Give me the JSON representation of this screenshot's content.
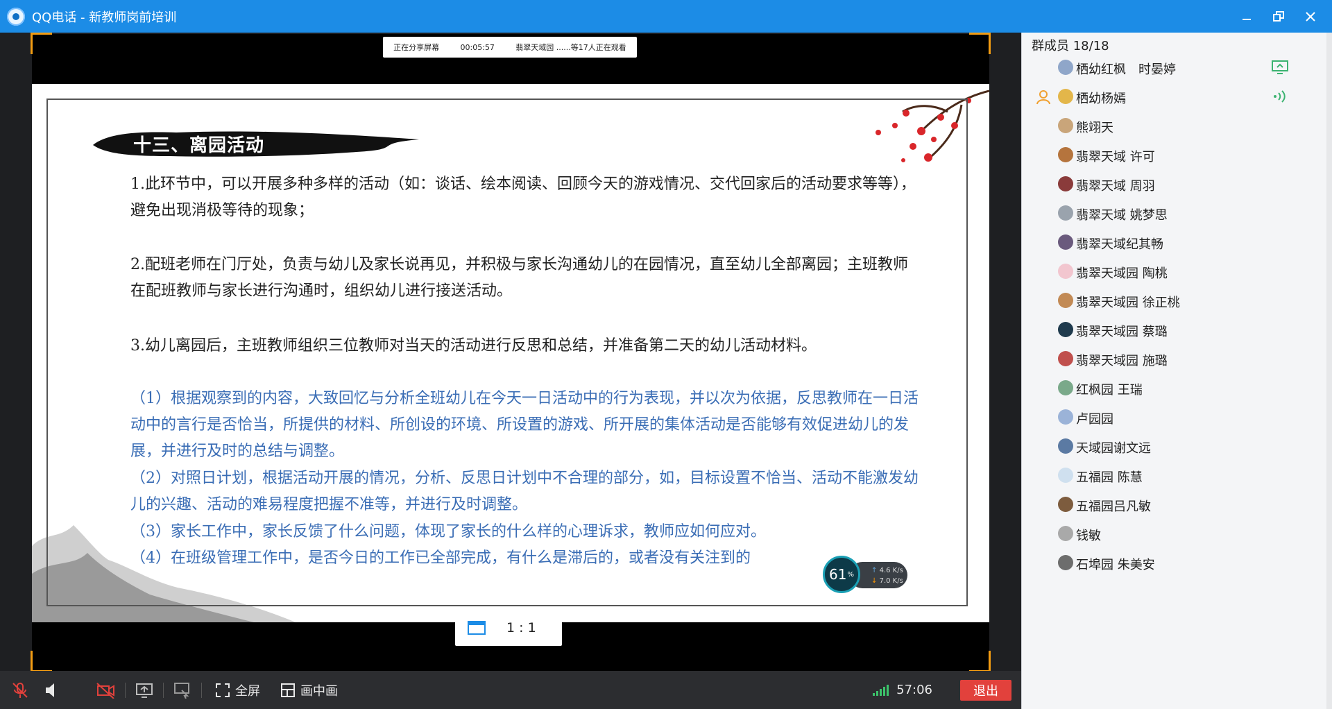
{
  "window": {
    "title": "QQ电话 - 新教师岗前培训"
  },
  "share_status": {
    "label": "正在分享屏幕",
    "elapsed": "00:05:57",
    "viewers": "翡翠天域园 ......等17人正在观看"
  },
  "slide": {
    "heading": "十三、离园活动",
    "paragraphs": [
      "1.此环节中，可以开展多种多样的活动（如：谈话、绘本阅读、回顾今天的游戏情况、交代回家后的活动要求等等），避免出现消极等待的现象；",
      "2.配班老师在门厅处，负责与幼儿及家长说再见，并积极与家长沟通幼儿的在园情况，直至幼儿全部离园；主班教师在配班教师与家长进行沟通时，组织幼儿进行接送活动。",
      "3.幼儿离园后，主班教师组织三位教师对当天的活动进行反思和总结，并准备第二天的幼儿活动材料。"
    ],
    "sub_points": [
      "（1）根据观察到的内容，大致回忆与分析全班幼儿在今天一日活动中的行为表现，并以次为依据，反思教师在一日活动中的言行是否恰当，所提供的材料、所创设的环境、所设置的游戏、所开展的集体活动是否能够有效促进幼儿的发展，并进行及时的总结与调整。",
      "（2）对照日计划，根据活动开展的情况，分析、反思日计划中不合理的部分，如，目标设置不恰当、活动不能激发幼儿的兴趣、活动的难易程度把握不准等，并进行及时调整。",
      "（3）家长工作中，家长反馈了什么问题，体现了家长的什么样的心理诉求，教师应如何应对。",
      "（4）在班级管理工作中，是否今日的工作已全部完成，有什么是滞后的，或者没有关注到的"
    ]
  },
  "network": {
    "percent": "61",
    "percent_unit": "%",
    "up": "4.6",
    "down": "7.0",
    "rate_unit": "K/s"
  },
  "ratio": {
    "label": "1 : 1"
  },
  "toolbar": {
    "fullscreen": "全屏",
    "pip": "画中画",
    "call_time": "57:06",
    "exit": "退出"
  },
  "members": {
    "header": "群成员 18/18",
    "list": [
      {
        "name": "栖幼红枫　时晏婷",
        "color": "#8fa6c9",
        "status": "screen-share"
      },
      {
        "name": "栖幼杨嫣",
        "color": "#e3b64a",
        "status": "speaking",
        "host": true
      },
      {
        "name": "熊翊天",
        "color": "#c9a57a"
      },
      {
        "name": "翡翠天域  许可",
        "color": "#b5743d"
      },
      {
        "name": "翡翠天域  周羽",
        "color": "#8a3b3b"
      },
      {
        "name": "翡翠天域 姚梦思",
        "color": "#9aa3ad"
      },
      {
        "name": "翡翠天域纪其畅",
        "color": "#6a5a7d"
      },
      {
        "name": "翡翠天域园  陶桃",
        "color": "#f2c6cf"
      },
      {
        "name": "翡翠天域园  徐正桃",
        "color": "#c28a55"
      },
      {
        "name": "翡翠天域园 蔡璐",
        "color": "#1f3a4d"
      },
      {
        "name": "翡翠天域园 施璐",
        "color": "#c0504d"
      },
      {
        "name": "红枫园 王瑞",
        "color": "#7aa98a"
      },
      {
        "name": "卢园园",
        "color": "#9bb3d8"
      },
      {
        "name": "天域园谢文远",
        "color": "#5b7aa3"
      },
      {
        "name": "五福园 陈慧",
        "color": "#cfe0ef"
      },
      {
        "name": "五福园吕凡敏",
        "color": "#7d5c3e"
      },
      {
        "name": "钱敏",
        "color": "#a9a9a9"
      },
      {
        "name": "石埠园 朱美安",
        "color": "#6d6d6d"
      }
    ]
  }
}
